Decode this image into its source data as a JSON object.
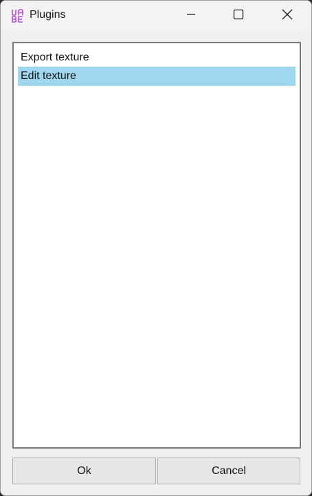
{
  "window": {
    "title": "Plugins",
    "app_icon": "uabe-logo-icon",
    "caption_buttons": [
      "minimize-icon",
      "maximize-icon",
      "close-icon"
    ]
  },
  "plugin_list": {
    "items": [
      {
        "label": "Export texture",
        "selected": false
      },
      {
        "label": "Edit texture",
        "selected": true
      }
    ],
    "selection_color": "#9fd8ee"
  },
  "buttons": {
    "ok_label": "Ok",
    "cancel_label": "Cancel"
  },
  "colors": {
    "app_icon_accent": "#b44fd6"
  }
}
